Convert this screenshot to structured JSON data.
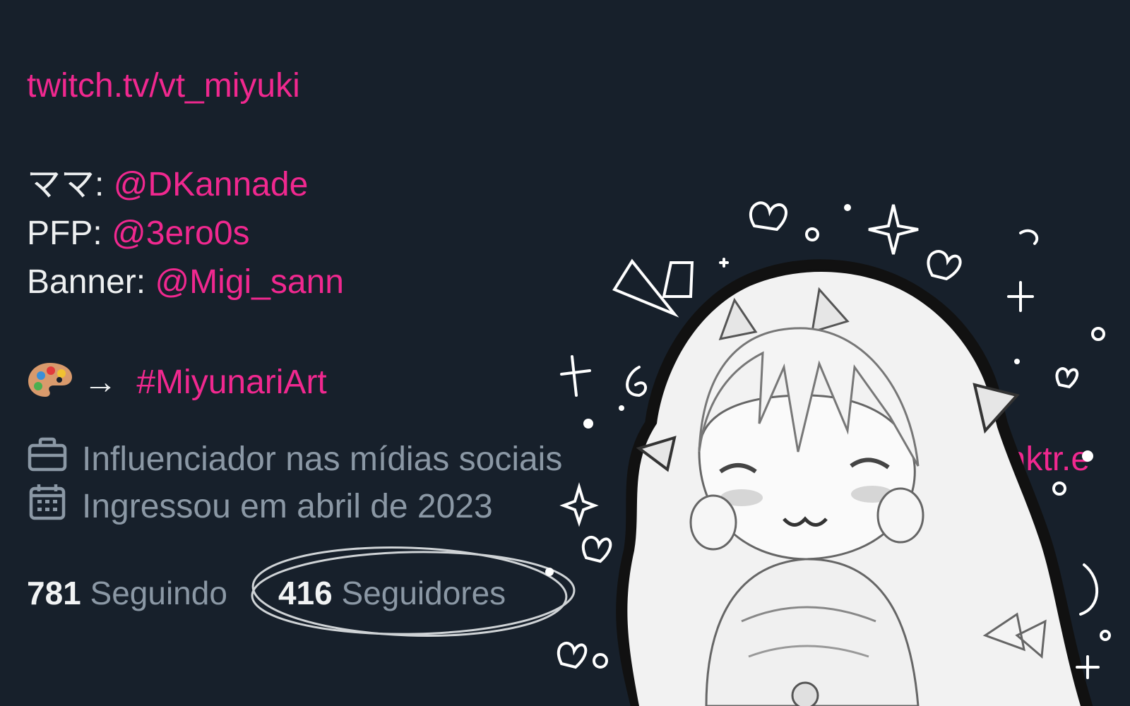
{
  "profile": {
    "twitch_link": "twitch.tv/vt_miyuki",
    "credits": [
      {
        "label": "ママ: ",
        "handle": "@DKannade"
      },
      {
        "label": "PFP: ",
        "handle": "@3ero0s"
      },
      {
        "label": "Banner: ",
        "handle": "@Migi_sann"
      }
    ],
    "art_arrow": "→",
    "art_hashtag": "#MiyunariArt",
    "category": "Influenciador nas mídias sociais",
    "website_partial": "linktr.e",
    "joined": "Ingressou em abril de 2023",
    "following_count": "781",
    "following_label": "Seguindo",
    "followers_count": "416",
    "followers_label": "Seguidores"
  },
  "icons": {
    "palette": "palette-emoji-icon",
    "category": "briefcase-icon",
    "joined": "calendar-icon",
    "website": "link-icon"
  },
  "colors": {
    "background": "#17202b",
    "link": "#f0288f",
    "primary_text": "#e7e9ea",
    "secondary_text": "#8b98a5"
  }
}
